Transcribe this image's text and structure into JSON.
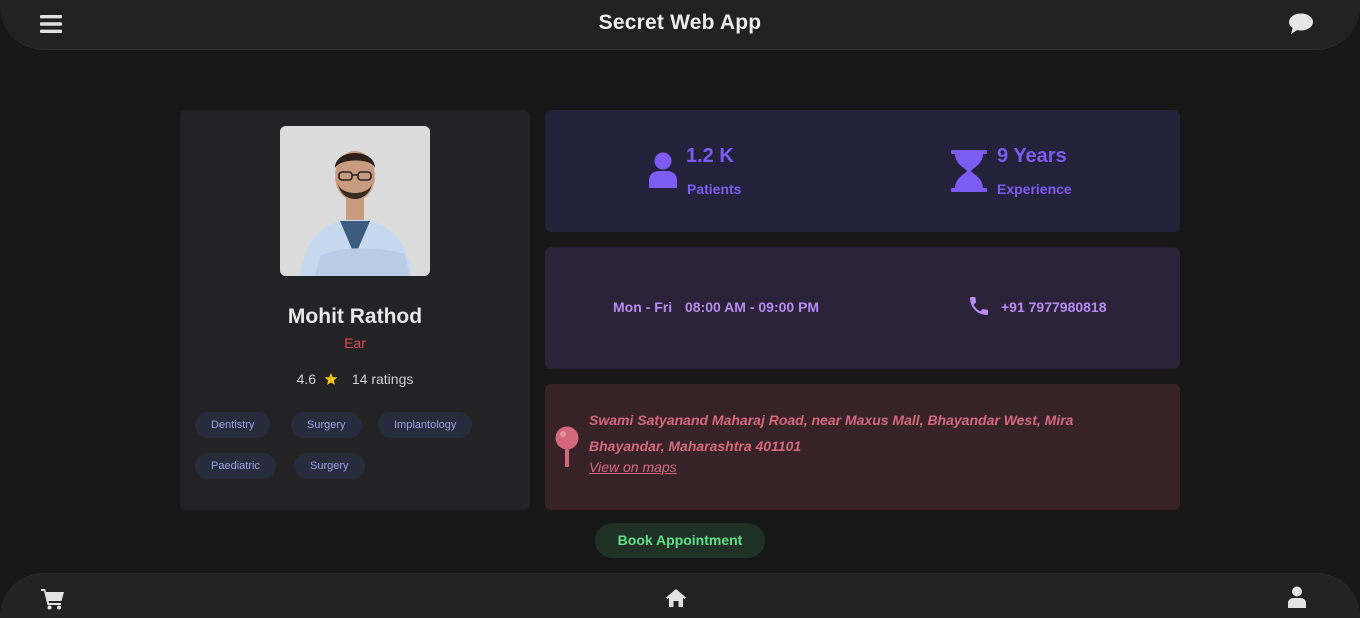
{
  "app": {
    "title": "Secret Web App"
  },
  "icons": {
    "menu": "menu-icon",
    "chat": "chat-icon",
    "patients": "user-icon",
    "experience": "hourglass-icon",
    "phone": "phone-icon",
    "location": "map-pin-icon",
    "cart": "cart-icon",
    "home": "home-icon",
    "profile": "user-icon"
  },
  "colors": {
    "accent_purple": "#7c5cf2",
    "specialty_red": "#e8434f",
    "address_pink": "#d4687c",
    "book_green": "#5fe08a"
  },
  "doctor": {
    "name": "Mohit Rathod",
    "specialty": "Ear",
    "rating": "4.6",
    "ratings_count": "14 ratings",
    "tags": [
      "Dentistry",
      "Surgery",
      "Implantology",
      "Paediatric",
      "Surgery"
    ]
  },
  "stats": {
    "patients_value": "1.2 K",
    "patients_label": "Patients",
    "experience_value": "9 Years",
    "experience_label": "Experience"
  },
  "schedule": {
    "days": "Mon - Fri",
    "hours": "08:00 AM - 09:00 PM",
    "phone": "+91 7977980818"
  },
  "address": {
    "text": "Swami Satyanand Maharaj Road, near Maxus Mall, Bhayandar West, Mira Bhayandar, Maharashtra 401101",
    "maps_link": "View on maps"
  },
  "actions": {
    "book_label": "Book Appointment"
  }
}
